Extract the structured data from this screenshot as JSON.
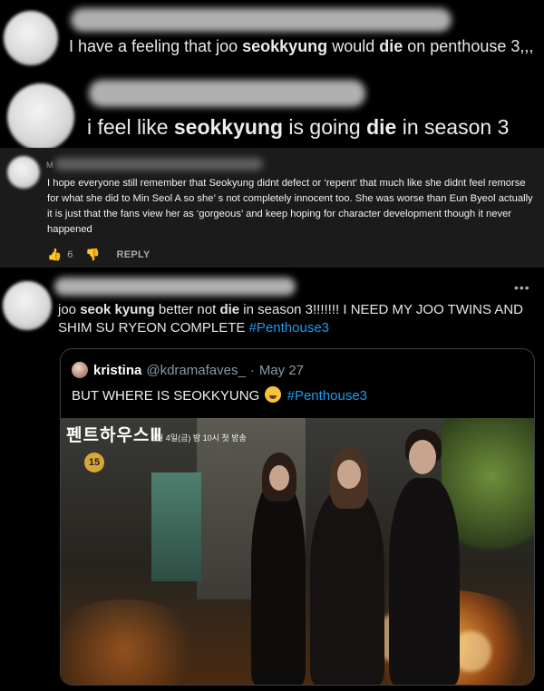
{
  "comment1": {
    "username_obscured": "#WELCOMEBACKLIAREEUL",
    "text_pre": "I have a feeling that joo ",
    "name": "seokkyung",
    "text_mid": " would ",
    "die": "die",
    "text_post": " on penthouse 3,,,"
  },
  "comment2": {
    "username_obscured": "开",
    "text_pre": "i feel like ",
    "name": "seokkyung",
    "text_mid": " is going ",
    "die": "die",
    "text_post": " in season 3"
  },
  "youtube_comment": {
    "username_initial": "M",
    "text": "I hope everyone still remember that Seokyung didnt defect or ‘repent’ that much like she didnt feel remorse for what she did to Min Seol A so she’ s not completely innocent too. She was worse than Eun Byeol actually it is just that the fans view her as ‘gorgeous’ and keep hoping for character development though it never happened",
    "like_count": "6",
    "reply_label": "REPLY"
  },
  "tweet": {
    "more_label": "•••",
    "text_pre": "joo ",
    "name": "seok kyung",
    "text_mid": " better not ",
    "die": "die",
    "text_post": " in season 3!!!!!!! I NEED MY JOO TWINS AND SHIM SU RYEON COMPLETE ",
    "hashtag": "#Penthouse3"
  },
  "quoted_tweet": {
    "display_name": "kristina",
    "handle": "@kdramafaves_",
    "separator": "·",
    "date": "May 27",
    "text_pre": "BUT WHERE IS SEOKKYUNG ",
    "hashtag": "#Penthouse3",
    "poster": {
      "title": "펜트하우스Ⅲ",
      "subtitle": "6월 4일(금) 밤 10시 첫 방송",
      "age_rating": "15"
    }
  },
  "colors": {
    "hashtag": "#1d9bf0",
    "background": "#000000",
    "youtube_bg": "#1b1b1b"
  }
}
